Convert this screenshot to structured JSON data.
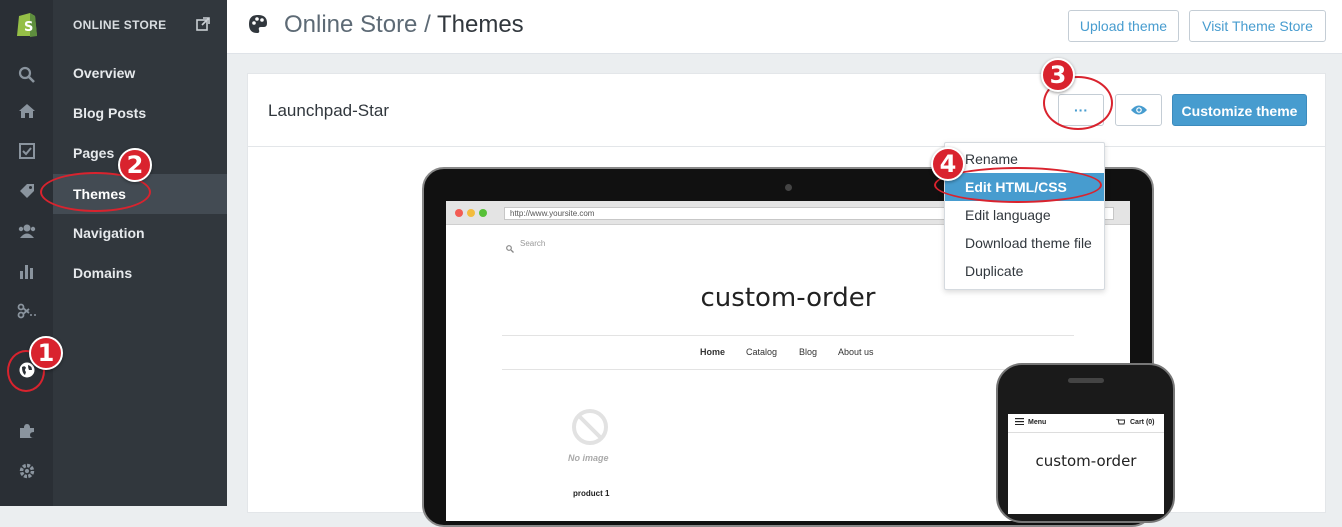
{
  "header": {
    "title_section": "Online Store",
    "title_separator": "/",
    "title_current": "Themes",
    "upload_label": "Upload theme",
    "visit_store_label": "Visit Theme Store"
  },
  "sidebar": {
    "header": "ONLINE STORE",
    "items": [
      {
        "label": "Overview"
      },
      {
        "label": "Blog Posts"
      },
      {
        "label": "Pages"
      },
      {
        "label": "Themes"
      },
      {
        "label": "Navigation"
      },
      {
        "label": "Domains"
      }
    ]
  },
  "iconbar": {
    "icons": [
      "shopify-logo-icon",
      "search-icon",
      "home-icon",
      "orders-icon",
      "tag-icon",
      "customers-icon",
      "reports-icon",
      "discounts-icon",
      "online-store-globe-icon",
      "apps-puzzle-icon",
      "settings-gear-icon"
    ]
  },
  "theme": {
    "name": "Launchpad-Star",
    "more_label": "···",
    "customize_label": "Customize theme"
  },
  "dropdown": {
    "items": [
      {
        "label": "Rename"
      },
      {
        "label": "Edit HTML/CSS"
      },
      {
        "label": "Edit language"
      },
      {
        "label": "Download theme file"
      },
      {
        "label": "Duplicate"
      }
    ]
  },
  "preview": {
    "url": "http://www.yoursite.com",
    "search": "Search",
    "site_title": "custom-order",
    "nav": [
      "Home",
      "Catalog",
      "Blog",
      "About us"
    ],
    "no_image": "No image",
    "product": "product 1",
    "mobile_menu": "Menu",
    "mobile_cart": "Cart (0)",
    "mobile_title": "custom-order"
  },
  "annotations": [
    "1",
    "2",
    "3",
    "4"
  ],
  "colors": {
    "accent": "#479ccf",
    "annotation_red": "#d9232e",
    "sidebar": "#31373d"
  }
}
